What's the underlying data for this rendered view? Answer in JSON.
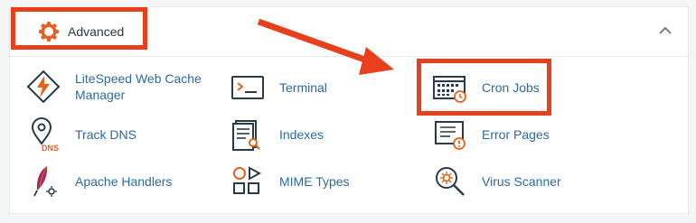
{
  "section": {
    "title": "Advanced",
    "header_icon": "gear-icon",
    "collapse_icon": "chevron-up-icon"
  },
  "items": [
    {
      "label": "LiteSpeed Web Cache Manager",
      "icon": "litespeed-icon"
    },
    {
      "label": "Terminal",
      "icon": "terminal-icon"
    },
    {
      "label": "Cron Jobs",
      "icon": "calendar-clock-icon"
    },
    {
      "label": "Track DNS",
      "icon": "dns-pin-icon"
    },
    {
      "label": "Indexes",
      "icon": "document-search-icon"
    },
    {
      "label": "Error Pages",
      "icon": "document-warning-icon"
    },
    {
      "label": "Apache Handlers",
      "icon": "feather-pen-icon"
    },
    {
      "label": "MIME Types",
      "icon": "shapes-play-icon"
    },
    {
      "label": "Virus Scanner",
      "icon": "virus-magnifier-icon"
    }
  ],
  "colors": {
    "accent_orange": "#e8601c",
    "annotation_red": "#e8401c",
    "link_blue": "#2c6aa0",
    "icon_dark": "#293a4a"
  }
}
